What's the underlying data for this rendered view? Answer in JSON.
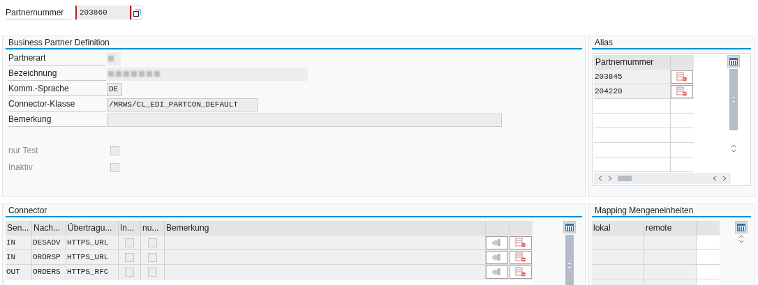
{
  "partner_number": {
    "label": "Partnernummer",
    "value": "203860"
  },
  "definition": {
    "title": "Business Partner Definition",
    "fields": [
      {
        "label": "Partnerart",
        "kind": "redacted"
      },
      {
        "label": "Bezeichnung",
        "kind": "redacted"
      },
      {
        "label": "Komm.-Sprache",
        "kind": "text",
        "value": "DE"
      },
      {
        "label": "Connector-Klasse",
        "kind": "text",
        "value": "/MRWS/CL_EDI_PARTCON_DEFAULT"
      },
      {
        "label": "Bemerkung",
        "kind": "text"
      }
    ],
    "checkboxes": [
      {
        "label": "nur Test",
        "checked": false,
        "disabled": true
      },
      {
        "label": "Inaktiv",
        "checked": false,
        "disabled": true
      }
    ]
  },
  "alias": {
    "title": "Alias",
    "columns": [
      "Partnernummer"
    ],
    "rows": [
      {
        "value": "203845"
      },
      {
        "value": "204220"
      }
    ]
  },
  "connector": {
    "title": "Connector",
    "columns": [
      "Sen...",
      "Nach...",
      "Übertragu...",
      "In...",
      "nu...",
      "Bemerkung"
    ],
    "rows": [
      {
        "direction": "IN",
        "message": "DESADV",
        "transport": "HTTPS_URL",
        "in": false,
        "nu": false
      },
      {
        "direction": "IN",
        "message": "ORDRSP",
        "transport": "HTTPS_URL",
        "in": false,
        "nu": false
      },
      {
        "direction": "OUT",
        "message": "ORDERS",
        "transport": "HTTPS_RFC",
        "in": false,
        "nu": false
      }
    ]
  },
  "mapping": {
    "title": "Mapping Mengeneinheiten",
    "columns": [
      "lokal",
      "remote"
    ]
  }
}
